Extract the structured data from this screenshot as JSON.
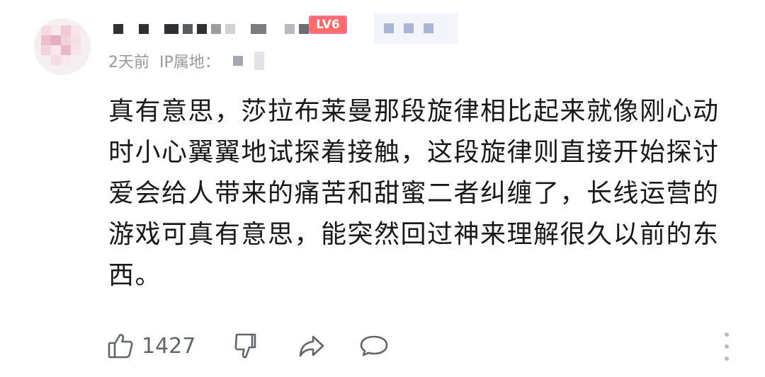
{
  "comment": {
    "level_badge": "LV6",
    "time": "2天前",
    "ip_label": "IP属地：",
    "text": "真有意思，莎拉布莱曼那段旋律相比起来就像刚心动时小心翼翼地试探着接触，这段旋律则直接开始探讨爱会给人带来的痛苦和甜蜜二者纠缠了，长线运营的游戏可真有意思，能突然回过神来理解很久以前的东西。"
  },
  "actions": {
    "like_count": "1427",
    "icons": [
      "thumbs-up-icon",
      "thumbs-down-icon",
      "share-icon",
      "comment-icon",
      "more-icon"
    ]
  },
  "colors": {
    "badge": "#ff6b6b",
    "meta_text": "#9499a0",
    "body_text": "#18191c",
    "action_icon": "#61666d"
  }
}
